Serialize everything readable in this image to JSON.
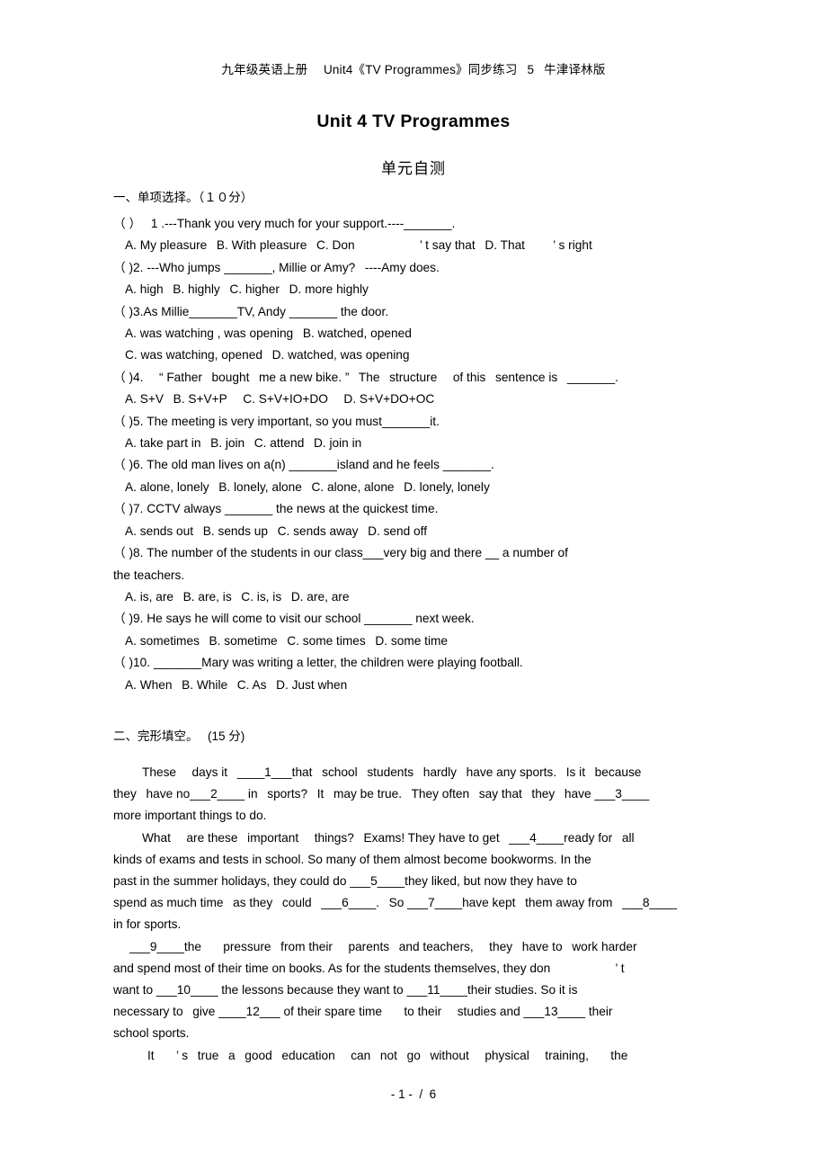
{
  "header": {
    "running_head": "九年级英语上册  Unit4《TV Programmes》同步练习  5  牛津译林版"
  },
  "title": {
    "main": "Unit 4 TV Programmes",
    "subtitle": "单元自测"
  },
  "sections": [
    {
      "heading": "一、单项选择。（１０分）",
      "questions": [
        {
          "stem": "（ ）  1 .---Thank you very much for your support.----_______.",
          "options": "A. My pleasure  B. With pleasure  C. Don      ’ t say that  D. That   ’ s right"
        },
        {
          "stem": "（ )2. ---Who jumps _______, Millie or Amy?  ----Amy does.",
          "options": "A. high  B. highly  C. higher  D. more highly"
        },
        {
          "stem": "（ )3.As Millie_______TV, Andy _______ the door.",
          "options": "A. was watching , was opening  B. watched, opened",
          "options2": "C. was watching, opened  D. watched, was opening"
        },
        {
          "stem": "（ )4.  “ Father  bought  me a new bike. ”  The  structure   of this  sentence is  _______.",
          "options": "A. S+V  B. S+V+P   C. S+V+IO+DO   D. S+V+DO+OC"
        },
        {
          "stem": "（ )5. The meeting is very important, so you must_______it.",
          "options": "A. take part in  B. join  C. attend  D. join in"
        },
        {
          "stem": "（ )6. The old man lives on a(n) _______island and he feels _______.",
          "options": "A. alone, lonely  B. lonely, alone  C. alone, alone  D. lonely, lonely"
        },
        {
          "stem": "（ )7. CCTV always _______ the news at the quickest time.",
          "options": "A. sends out  B. sends up  C. sends away  D. send off"
        },
        {
          "stem": "（ )8. The number of the students in our class___very big and there __ a number of",
          "stem2": "the teachers.",
          "options": "A. is, are  B. are, is  C. is, is  D. are, are"
        },
        {
          "stem": "（ )9. He says he will come to visit our school _______ next week.",
          "options": "A. sometimes  B. sometime  C. some times  D. some time"
        },
        {
          "stem": "（ )10. _______Mary was writing a letter, the children were playing football.",
          "options": "A. When  B. While  C. As  D. Just when"
        }
      ]
    },
    {
      "heading": "二、完形填空。  (15 分)",
      "paragraphs": [
        {
          "lines": [
            "These  days it  ____1___that  school  students  hardly  have any sports.  Is it  because",
            "they  have no___2____ in  sports?  It  may be true.  They often  say that  they  have ___3____",
            "more important things to do."
          ]
        },
        {
          "lines": [
            "What  are these  important   things?  Exams! They have to get  ___4____ready for  all",
            "kinds of exams and tests in school. So many of them almost become bookworms. In the",
            "past in the summer holidays, they could do ___5____they liked, but now they have to",
            "spend as much time  as they  could  ___6____.  So ___7____have kept  them away from  ___8____",
            "in for sports."
          ]
        },
        {
          "lines": [
            "___9____the   pressure  from their   parents  and teachers,   they  have to  work harder",
            "and spend most of their time on books. As for the students themselves, they don      ’ t",
            "want to ___10____ the lessons because they want to ___11____their studies. So it is",
            "necessary to  give ____12___ of their spare time   to their   studies and ___13____ their",
            "school sports."
          ]
        },
        {
          "lines": [
            "It   ’ s  true  a  good  education   can  not  go  without   physical   training,   the"
          ]
        }
      ]
    }
  ],
  "footer": {
    "page_indicator": "- 1 -  /  6"
  }
}
